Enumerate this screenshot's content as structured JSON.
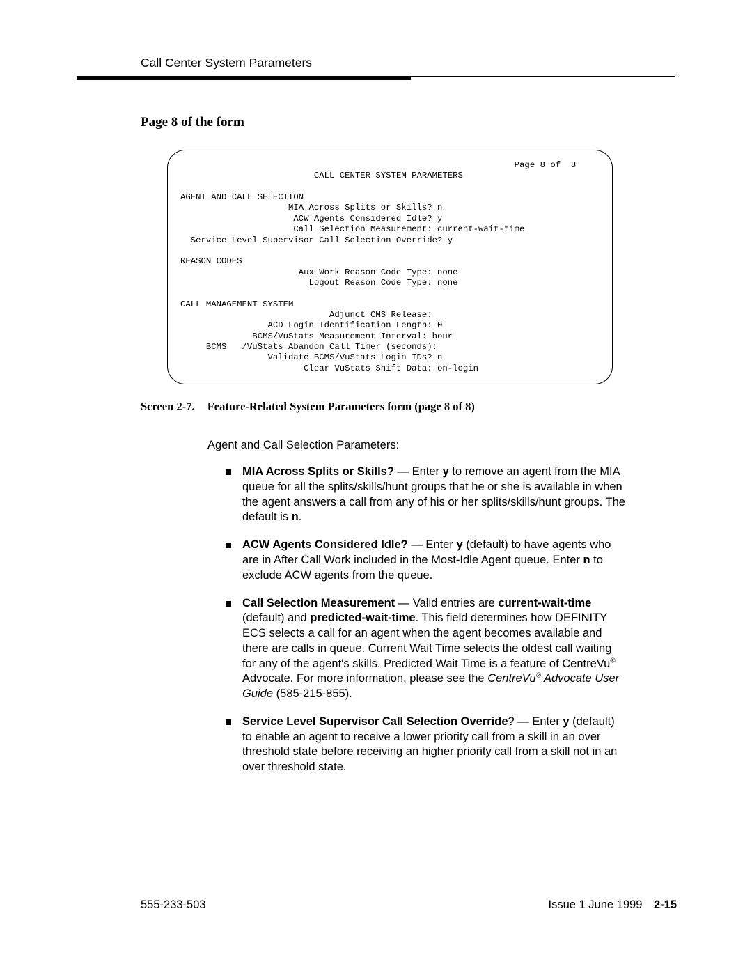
{
  "header": {
    "title": "Call Center System Parameters"
  },
  "section_heading": "Page 8 of the form",
  "terminal": {
    "page_label": "Page 8 of  8",
    "title": "CALL CENTER SYSTEM PARAMETERS",
    "agent_heading": "AGENT AND CALL SELECTION",
    "mia_line": "                     MIA Across Splits or Skills? n",
    "acw_line": "                      ACW Agents Considered Idle? y",
    "csm_line": "                      Call Selection Measurement: current-wait-time",
    "sls_line": "  Service Level Supervisor Call Selection Override? y",
    "reason_heading": "REASON CODES",
    "aux_line": "                       Aux Work Reason Code Type: none",
    "logout_line": "                         Logout Reason Code Type: none",
    "cms_heading": "CALL MANAGEMENT SYSTEM",
    "adj_line": "                             Adjunct CMS Release:",
    "acd_line": "                 ACD Login Identification Length: 0",
    "bcmsint_line": "              BCMS/VuStats Measurement Interval: hour",
    "bcmsab_line": "     BCMS   /VuStats Abandon Call Timer (seconds):",
    "validate_line": "                 Validate BCMS/VuStats Login IDs? n",
    "clear_line": "                        Clear VuStats Shift Data: on-login"
  },
  "caption": {
    "label": "Screen 2-7.",
    "text": "Feature-Related System Parameters form (page 8 of 8)"
  },
  "body_intro": "Agent and Call Selection Parameters:",
  "bullets": {
    "b1_lead": "MIA Across Splits or Skills?",
    "b1_mid1": " — Enter ",
    "b1_y": "y",
    "b1_rest": " to remove an agent from the MIA queue for all the splits/skills/hunt groups that he or she is available in when the agent answers a call from any of his or her splits/skills/hunt groups. The default is ",
    "b1_n": "n",
    "b1_end": ".",
    "b2_lead": "ACW Agents Considered Idle?",
    "b2_mid1": " — Enter ",
    "b2_y": "y",
    "b2_mid2": " (default) to have agents who are in After Call Work included in the Most-Idle Agent queue. Enter ",
    "b2_n": "n",
    "b2_end": " to exclude ACW agents from the queue.",
    "b3_lead": "Call Selection Measurement",
    "b3_mid1": " — Valid entries are ",
    "b3_cwt": "current-wait-time",
    "b3_mid2": " (default) and ",
    "b3_pwt": "predicted-wait-time",
    "b3_mid3": ". This field determines how DEFINITY ECS selects a call for an agent when the agent becomes available and there are calls in queue. Current Wait Time selects the oldest call waiting for any of the agent's skills. Predicted Wait Time is a feature of CentreVu",
    "b3_mid4": " Advocate. For more information, please see the ",
    "b3_ital": "CentreVu",
    "b3_ital2": " Advocate User Guide",
    "b3_end": " (585-215-855).",
    "b4_lead": "Service Level Supervisor Call Selection Override",
    "b4_q": "?",
    "b4_mid1": " — Enter ",
    "b4_y": "y",
    "b4_end": " (default) to enable an agent to receive a lower priority call from a skill in an over threshold state before receiving an higher priority call from a skill not in an over threshold state."
  },
  "footer": {
    "docnum": "555-233-503",
    "issue": "Issue 1 June 1999",
    "page": "2-15"
  }
}
